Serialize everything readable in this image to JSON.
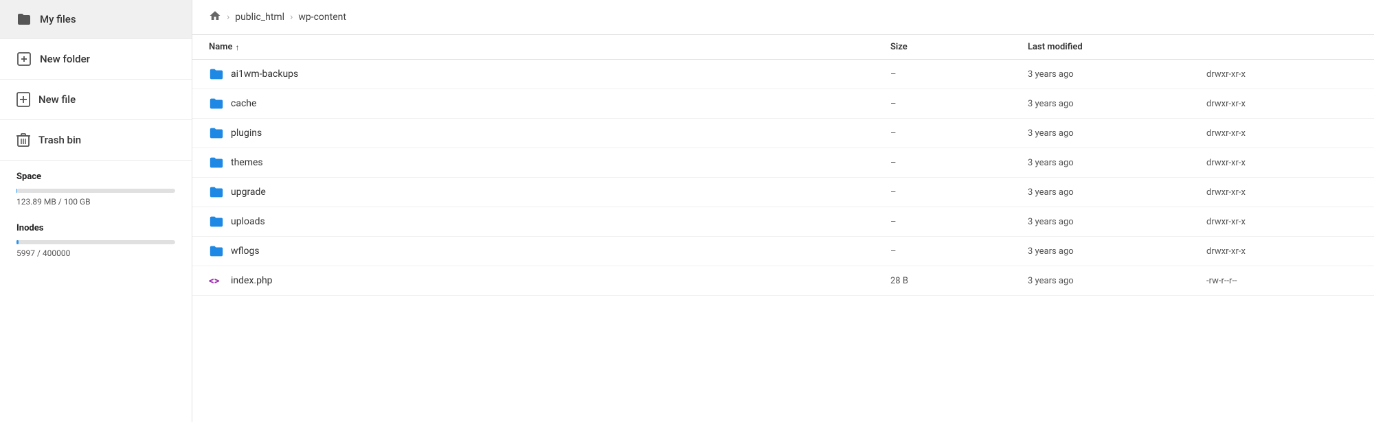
{
  "sidebar": {
    "my_files_label": "My files",
    "new_folder_label": "New folder",
    "new_file_label": "New file",
    "trash_bin_label": "Trash bin",
    "space_label": "Space",
    "space_used": "123.89 MB / 100 GB",
    "space_percent": 0.12,
    "inodes_label": "Inodes",
    "inodes_used": "5997 / 400000",
    "inodes_percent": 1.5
  },
  "breadcrumb": {
    "home_title": "home",
    "sep1": ">",
    "crumb1": "public_html",
    "sep2": ">",
    "crumb2": "wp-content"
  },
  "table": {
    "col_name": "Name",
    "col_size": "Size",
    "col_modified": "Last modified",
    "col_perms": "",
    "sort_arrow": "↑",
    "rows": [
      {
        "name": "ai1wm-backups",
        "type": "folder",
        "size": "–",
        "modified": "3 years ago",
        "perms": "drwxr-xr-x"
      },
      {
        "name": "cache",
        "type": "folder",
        "size": "–",
        "modified": "3 years ago",
        "perms": "drwxr-xr-x"
      },
      {
        "name": "plugins",
        "type": "folder",
        "size": "–",
        "modified": "3 years ago",
        "perms": "drwxr-xr-x"
      },
      {
        "name": "themes",
        "type": "folder",
        "size": "–",
        "modified": "3 years ago",
        "perms": "drwxr-xr-x"
      },
      {
        "name": "upgrade",
        "type": "folder",
        "size": "–",
        "modified": "3 years ago",
        "perms": "drwxr-xr-x"
      },
      {
        "name": "uploads",
        "type": "folder",
        "size": "–",
        "modified": "3 years ago",
        "perms": "drwxr-xr-x"
      },
      {
        "name": "wflogs",
        "type": "folder",
        "size": "–",
        "modified": "3 years ago",
        "perms": "drwxr-xr-x"
      },
      {
        "name": "index.php",
        "type": "code",
        "size": "28 B",
        "modified": "3 years ago",
        "perms": "-rw-r--r--"
      }
    ]
  }
}
